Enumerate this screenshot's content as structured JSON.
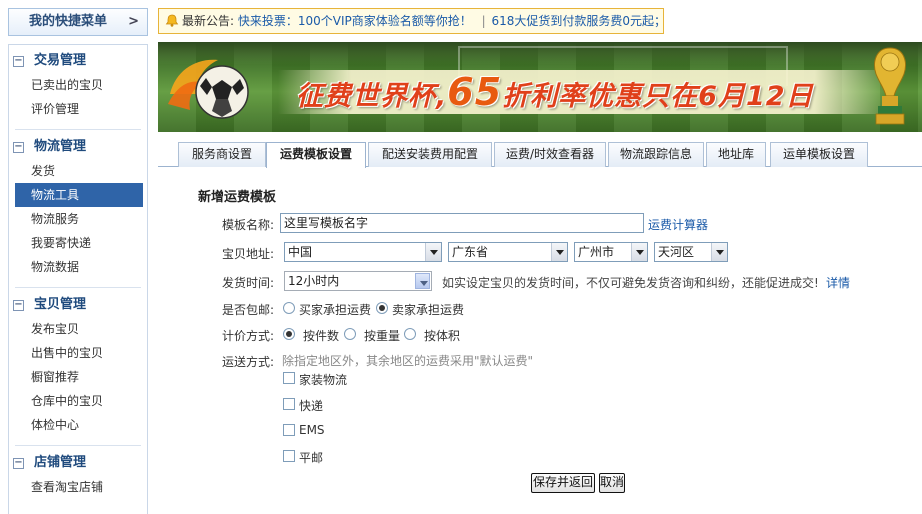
{
  "sidebar": {
    "quick_menu_label": "我的快捷菜单",
    "quick_menu_arrow": ">",
    "groups": [
      {
        "title": "交易管理",
        "items": [
          "已卖出的宝贝",
          "评价管理"
        ]
      },
      {
        "title": "物流管理",
        "items": [
          "发货",
          "物流工具",
          "物流服务",
          "我要寄快递",
          "物流数据"
        ]
      },
      {
        "title": "宝贝管理",
        "items": [
          "发布宝贝",
          "出售中的宝贝",
          "橱窗推荐",
          "仓库中的宝贝",
          "体检中心"
        ]
      },
      {
        "title": "店铺管理",
        "items": [
          "查看淘宝店铺"
        ]
      }
    ],
    "active_item": "物流工具",
    "collapse_symbol": "−"
  },
  "notice": {
    "label": "最新公告:",
    "items": [
      "快来投票：100个VIP商家体验名额等你抢！",
      "618大促货到付款服务费0元起；"
    ],
    "separator": "|"
  },
  "banner": {
    "slogan_part1": "征费世界杯,",
    "slogan_number": "65",
    "slogan_part2": "折利率优惠只在6月12日"
  },
  "tabs": [
    "服务商设置",
    "运费模板设置",
    "配送安装费用配置",
    "运费/时效查看器",
    "物流跟踪信息",
    "地址库",
    "运单模板设置"
  ],
  "active_tab": "运费模板设置",
  "form": {
    "title": "新增运费模板",
    "name_label": "模板名称:",
    "name_value": "这里写模板名字",
    "calculator_link": "运费计算器",
    "address_label": "宝贝地址:",
    "country": "中国",
    "province": "广东省",
    "city": "广州市",
    "district": "天河区",
    "ship_time_label": "发货时间:",
    "ship_time_value": "12小时内",
    "ship_time_hint": "如实设定宝贝的发货时间，不仅可避免发货咨询和纠纷，还能促进成交!",
    "ship_time_detail_link": "详情",
    "free_ship_label": "是否包邮:",
    "free_ship_options": [
      "买家承担运费",
      "卖家承担运费"
    ],
    "free_ship_selected": 1,
    "pricing_label": "计价方式:",
    "pricing_options": [
      "按件数",
      "按重量",
      "按体积"
    ],
    "pricing_selected": 0,
    "delivery_label": "运送方式:",
    "delivery_hint": "除指定地区外，其余地区的运费采用\"默认运费\"",
    "delivery_options": [
      "家装物流",
      "快递",
      "EMS",
      "平邮"
    ],
    "save_button": "保存并返回",
    "cancel_button": "取消"
  },
  "colors": {
    "accent": "#2f64a8",
    "link": "#1a5aa8",
    "notice_border": "#e7b43a",
    "slogan": "#e0401a"
  }
}
